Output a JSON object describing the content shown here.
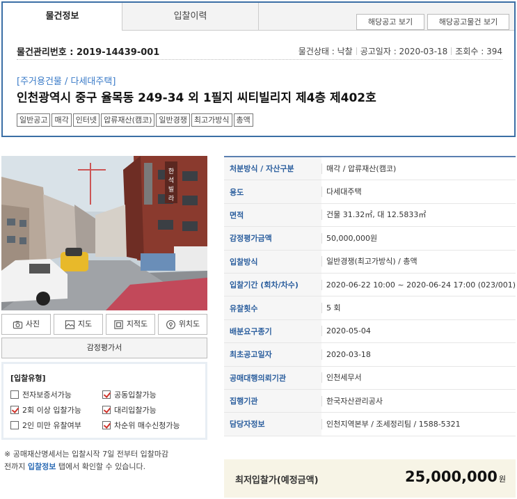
{
  "tabs": {
    "info": "물건정보",
    "history": "입찰이력"
  },
  "top_buttons": {
    "view_notice": "해당공고 보기",
    "view_notice_items": "해당공고물건 보기"
  },
  "item": {
    "mgmt_label": "물건관리번호 : 2019-14439-001",
    "status": "물건상태 : 낙찰",
    "notice_date": "공고일자 : 2020-03-18",
    "views": "조회수 : 394",
    "category": "[주거용건물 / 다세대주택]",
    "address": "인천광역시 중구 율목동 249-34 외 1필지 씨티빌리지 제4층 제402호",
    "tags": [
      "일반공고",
      "매각",
      "인터넷",
      "압류재산(캠코)",
      "일반경쟁",
      "최고가방식",
      "총액"
    ]
  },
  "media": {
    "photo": "사진",
    "map": "지도",
    "cadastral": "지적도",
    "location": "위치도",
    "appraisal": "감정평가서"
  },
  "bid_type": {
    "title": "[입찰유형]",
    "options": [
      {
        "label": "전자보증서가능",
        "checked": false
      },
      {
        "label": "공동입찰가능",
        "checked": true
      },
      {
        "label": "2회 이상 입찰가능",
        "checked": true
      },
      {
        "label": "대리입찰가능",
        "checked": true
      },
      {
        "label": "2인 미만 유찰여부",
        "checked": false
      },
      {
        "label": "차순위 매수신청가능",
        "checked": true
      }
    ]
  },
  "note": {
    "line1": "※ 공매재산명세서는 입찰시작 7일 전부터 입찰마감",
    "line2_pre": "전까지 ",
    "line2_link": "입찰정보",
    "line2_post": " 탭에서 확인할 수 있습니다."
  },
  "details": [
    {
      "label": "처분방식 / 자산구분",
      "value": "매각 / 압류재산(캠코)"
    },
    {
      "label": "용도",
      "value": "다세대주택"
    },
    {
      "label": "면적",
      "value": "건물 31.32㎡, 대 12.5833㎡"
    },
    {
      "label": "감정평가금액",
      "value": "50,000,000원"
    },
    {
      "label": "입찰방식",
      "value": "일반경쟁(최고가방식) / 총액"
    },
    {
      "label": "입찰기간 (회차/차수)",
      "value": "2020-06-22 10:00 ~ 2020-06-24 17:00 (023/001)"
    },
    {
      "label": "유찰횟수",
      "value": "5 회"
    },
    {
      "label": "배분요구종기",
      "value": "2020-05-04"
    },
    {
      "label": "최초공고일자",
      "value": "2020-03-18"
    },
    {
      "label": "공매대행의뢰기관",
      "value": "인천세무서"
    },
    {
      "label": "집행기관",
      "value": "한국자산관리공사"
    },
    {
      "label": "담당자정보",
      "value": "인천지역본부 / 조세정리팀 / 1588-5321"
    }
  ],
  "min_price": {
    "label": "최저입찰가(예정금액)",
    "value": "25,000,000",
    "unit": "원"
  }
}
